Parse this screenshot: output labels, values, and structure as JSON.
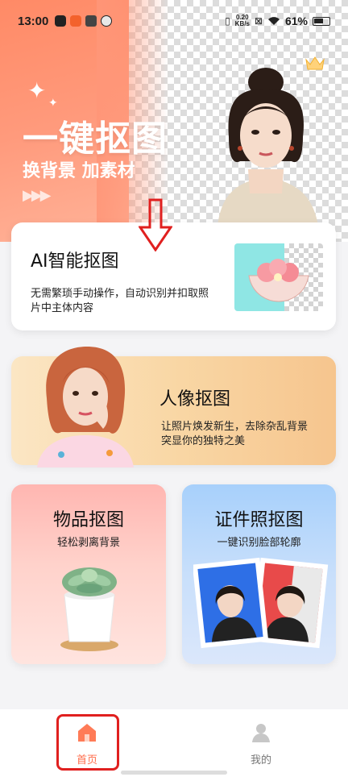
{
  "status_bar": {
    "time": "13:00",
    "net_speed_value": "0.20",
    "net_speed_unit": "KB/s",
    "battery_percent": "61%"
  },
  "hero": {
    "title": "一键抠图",
    "subtitle": "换背景 加素材"
  },
  "ai_card": {
    "title": "AI智能抠图",
    "description": "无需繁琐手动操作，自动识别并扣取照片中主体内容"
  },
  "portrait_card": {
    "title": "人像抠图",
    "description": "让照片焕发新生，去除杂乱背景突显你的独特之美"
  },
  "object_card": {
    "title": "物品抠图",
    "description": "轻松剥离背景"
  },
  "id_card": {
    "title": "证件照抠图",
    "description": "一键识别脸部轮廓"
  },
  "bottom_nav": {
    "home_label": "首页",
    "mine_label": "我的"
  },
  "colors": {
    "accent": "#ff6d4b",
    "hero": "#ff8a66",
    "highlight": "#e0201f"
  }
}
